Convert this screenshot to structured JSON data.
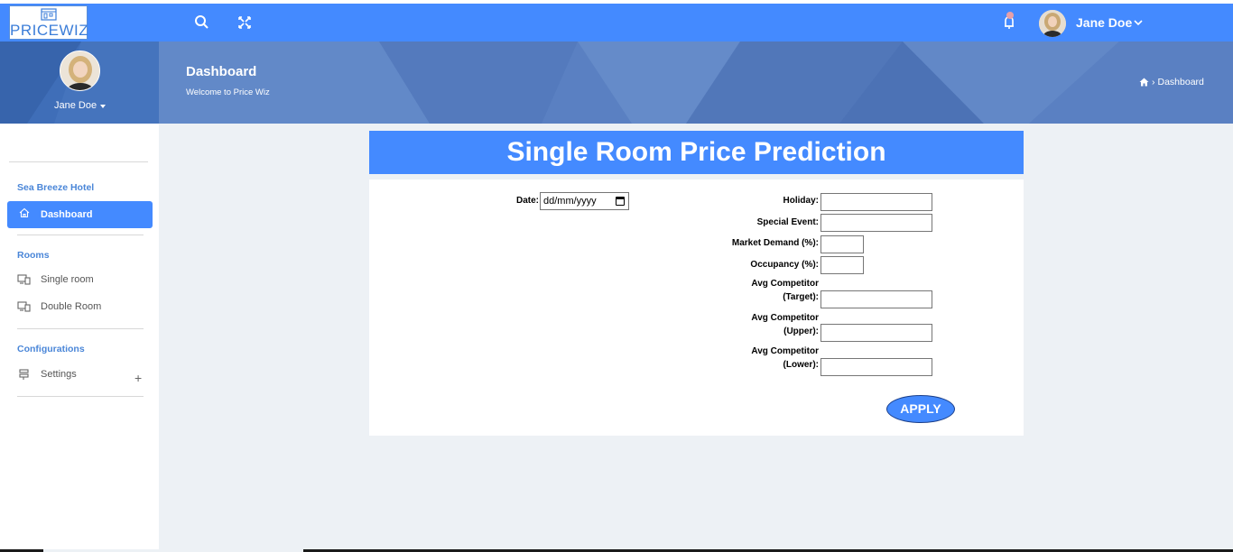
{
  "brand": {
    "logo_text": "PRICEWIZ"
  },
  "navbar": {
    "user_name": "Jane Doe",
    "icons": [
      "search-icon",
      "expand-icon",
      "bell-icon",
      "chevron-down-icon"
    ]
  },
  "profile": {
    "name": "Jane Doe"
  },
  "banner": {
    "title": "Dashboard",
    "subtitle": "Welcome to Price Wiz",
    "breadcrumb": "Dashboard"
  },
  "sidebar": {
    "hotel_heading": "Sea Breeze Hotel",
    "dashboard_label": "Dashboard",
    "rooms_heading": "Rooms",
    "single_room": "Single room",
    "double_room": "Double Room",
    "config_heading": "Configurations",
    "settings": "Settings",
    "settings_expand": "+"
  },
  "form": {
    "title": "Single Room Price Prediction",
    "date_label": "Date:",
    "date_placeholder": "dd/mm/yyyy",
    "holiday_label": "Holiday:",
    "special_event_label": "Special Event:",
    "market_demand_label": "Market Demand (%):",
    "occupancy_label": "Occupancy (%):",
    "avg_target_label_1": "Avg Competitor",
    "avg_target_label_2": "(Target):",
    "avg_upper_label_1": "Avg Competitor",
    "avg_upper_label_2": "(Upper):",
    "avg_lower_label_1": "Avg Competitor",
    "avg_lower_label_2": "(Lower):",
    "apply_label": "APPLY"
  },
  "colors": {
    "primary": "#448aff",
    "banner": "#5a80c2",
    "main_bg": "#edf1f5",
    "sidebar_heading": "#4a86d8"
  }
}
